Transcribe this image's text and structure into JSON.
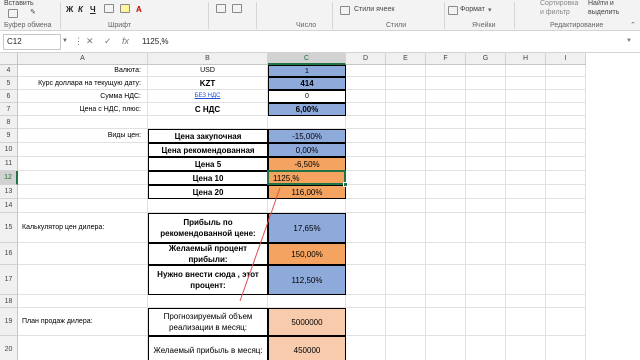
{
  "ribbon": {
    "paste_label": "Вставить",
    "groups": [
      "Буфер обмена",
      "Шрифт",
      "Число",
      "Стили",
      "Ячейки",
      "Редактирование"
    ],
    "font_buttons": [
      "Ж",
      "К",
      "Ч"
    ],
    "styles_label": "Стили ячеек",
    "format_label": "Формат",
    "sort_label": "Сортировка",
    "sort_label2": "и фильтр",
    "find_label": "Найти и",
    "find_label2": "выделить"
  },
  "formula_bar": {
    "name_box": "C12",
    "cancel": "✕",
    "enter": "✓",
    "fx": "fx",
    "value": "1125,%"
  },
  "columns": [
    "A",
    "B",
    "C",
    "D",
    "E",
    "F",
    "G",
    "H",
    "I"
  ],
  "rows": [
    "4",
    "5",
    "6",
    "7",
    "8",
    "9",
    "10",
    "11",
    "12",
    "13",
    "14",
    "15",
    "16",
    "17",
    "18",
    "19",
    "20"
  ],
  "cells": {
    "A4": "Валюта:",
    "B4": "USD",
    "C4": "1",
    "A5": "Курс доллара на текущую дату:",
    "B5": "KZT",
    "C5": "414",
    "A6": "Сумма НДС:",
    "B6": "БЕЗ НДС",
    "C6": "0",
    "A7": "Цена с НДС, плюс:",
    "B7": "С НДС",
    "C7": "6,00%",
    "A9": "Виды цен:",
    "B9": "Цена закупочная",
    "C9": "-15,00%",
    "B10": "Цена рекомендованная",
    "C10": "0,00%",
    "B11": "Цена 5",
    "C11": "-6,50%",
    "B12": "Цена 10",
    "C12": "1125,%",
    "B13": "Цена 20",
    "C13": "116,00%",
    "A15": "Калькулятор цен дилера:",
    "B15": "Прибыль по рекомендованной цене:",
    "C15": "17,65%",
    "B16": "Желаемый процент прибыли:",
    "C16": "150,00%",
    "B17": "Нужно внести сюда , этот процент:",
    "C17": "112,50%",
    "A19": "План продаж дилера:",
    "B19": "Прогнозируемый объем реализации в месяц:",
    "C19": "5000000",
    "B20": "Желаемый прибыль в месяц:",
    "C20": "450000"
  },
  "colors": {
    "accent": "#217346",
    "blue_fill": "#8eaadb",
    "orange_fill": "#f4a460",
    "peach_fill": "#f8cbad",
    "annotation_line": "#e05050"
  }
}
